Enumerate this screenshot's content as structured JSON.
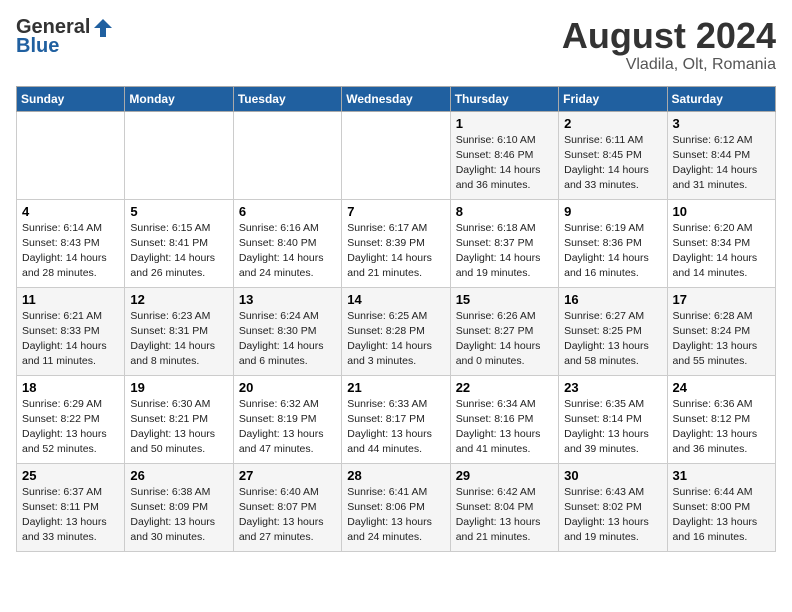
{
  "header": {
    "logo_general": "General",
    "logo_blue": "Blue",
    "month_title": "August 2024",
    "location": "Vladila, Olt, Romania"
  },
  "weekdays": [
    "Sunday",
    "Monday",
    "Tuesday",
    "Wednesday",
    "Thursday",
    "Friday",
    "Saturday"
  ],
  "weeks": [
    [
      {
        "day": "",
        "info": ""
      },
      {
        "day": "",
        "info": ""
      },
      {
        "day": "",
        "info": ""
      },
      {
        "day": "",
        "info": ""
      },
      {
        "day": "1",
        "info": "Sunrise: 6:10 AM\nSunset: 8:46 PM\nDaylight: 14 hours and 36 minutes."
      },
      {
        "day": "2",
        "info": "Sunrise: 6:11 AM\nSunset: 8:45 PM\nDaylight: 14 hours and 33 minutes."
      },
      {
        "day": "3",
        "info": "Sunrise: 6:12 AM\nSunset: 8:44 PM\nDaylight: 14 hours and 31 minutes."
      }
    ],
    [
      {
        "day": "4",
        "info": "Sunrise: 6:14 AM\nSunset: 8:43 PM\nDaylight: 14 hours and 28 minutes."
      },
      {
        "day": "5",
        "info": "Sunrise: 6:15 AM\nSunset: 8:41 PM\nDaylight: 14 hours and 26 minutes."
      },
      {
        "day": "6",
        "info": "Sunrise: 6:16 AM\nSunset: 8:40 PM\nDaylight: 14 hours and 24 minutes."
      },
      {
        "day": "7",
        "info": "Sunrise: 6:17 AM\nSunset: 8:39 PM\nDaylight: 14 hours and 21 minutes."
      },
      {
        "day": "8",
        "info": "Sunrise: 6:18 AM\nSunset: 8:37 PM\nDaylight: 14 hours and 19 minutes."
      },
      {
        "day": "9",
        "info": "Sunrise: 6:19 AM\nSunset: 8:36 PM\nDaylight: 14 hours and 16 minutes."
      },
      {
        "day": "10",
        "info": "Sunrise: 6:20 AM\nSunset: 8:34 PM\nDaylight: 14 hours and 14 minutes."
      }
    ],
    [
      {
        "day": "11",
        "info": "Sunrise: 6:21 AM\nSunset: 8:33 PM\nDaylight: 14 hours and 11 minutes."
      },
      {
        "day": "12",
        "info": "Sunrise: 6:23 AM\nSunset: 8:31 PM\nDaylight: 14 hours and 8 minutes."
      },
      {
        "day": "13",
        "info": "Sunrise: 6:24 AM\nSunset: 8:30 PM\nDaylight: 14 hours and 6 minutes."
      },
      {
        "day": "14",
        "info": "Sunrise: 6:25 AM\nSunset: 8:28 PM\nDaylight: 14 hours and 3 minutes."
      },
      {
        "day": "15",
        "info": "Sunrise: 6:26 AM\nSunset: 8:27 PM\nDaylight: 14 hours and 0 minutes."
      },
      {
        "day": "16",
        "info": "Sunrise: 6:27 AM\nSunset: 8:25 PM\nDaylight: 13 hours and 58 minutes."
      },
      {
        "day": "17",
        "info": "Sunrise: 6:28 AM\nSunset: 8:24 PM\nDaylight: 13 hours and 55 minutes."
      }
    ],
    [
      {
        "day": "18",
        "info": "Sunrise: 6:29 AM\nSunset: 8:22 PM\nDaylight: 13 hours and 52 minutes."
      },
      {
        "day": "19",
        "info": "Sunrise: 6:30 AM\nSunset: 8:21 PM\nDaylight: 13 hours and 50 minutes."
      },
      {
        "day": "20",
        "info": "Sunrise: 6:32 AM\nSunset: 8:19 PM\nDaylight: 13 hours and 47 minutes."
      },
      {
        "day": "21",
        "info": "Sunrise: 6:33 AM\nSunset: 8:17 PM\nDaylight: 13 hours and 44 minutes."
      },
      {
        "day": "22",
        "info": "Sunrise: 6:34 AM\nSunset: 8:16 PM\nDaylight: 13 hours and 41 minutes."
      },
      {
        "day": "23",
        "info": "Sunrise: 6:35 AM\nSunset: 8:14 PM\nDaylight: 13 hours and 39 minutes."
      },
      {
        "day": "24",
        "info": "Sunrise: 6:36 AM\nSunset: 8:12 PM\nDaylight: 13 hours and 36 minutes."
      }
    ],
    [
      {
        "day": "25",
        "info": "Sunrise: 6:37 AM\nSunset: 8:11 PM\nDaylight: 13 hours and 33 minutes."
      },
      {
        "day": "26",
        "info": "Sunrise: 6:38 AM\nSunset: 8:09 PM\nDaylight: 13 hours and 30 minutes."
      },
      {
        "day": "27",
        "info": "Sunrise: 6:40 AM\nSunset: 8:07 PM\nDaylight: 13 hours and 27 minutes."
      },
      {
        "day": "28",
        "info": "Sunrise: 6:41 AM\nSunset: 8:06 PM\nDaylight: 13 hours and 24 minutes."
      },
      {
        "day": "29",
        "info": "Sunrise: 6:42 AM\nSunset: 8:04 PM\nDaylight: 13 hours and 21 minutes."
      },
      {
        "day": "30",
        "info": "Sunrise: 6:43 AM\nSunset: 8:02 PM\nDaylight: 13 hours and 19 minutes."
      },
      {
        "day": "31",
        "info": "Sunrise: 6:44 AM\nSunset: 8:00 PM\nDaylight: 13 hours and 16 minutes."
      }
    ]
  ]
}
